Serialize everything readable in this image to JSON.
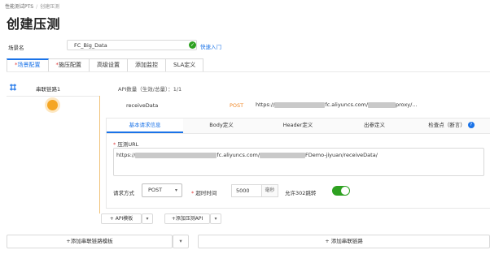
{
  "breadcrumb": {
    "root": "性能测试PTS",
    "separator": "/",
    "current": "创建压测"
  },
  "page_title": "创建压测",
  "scene": {
    "label": "场景名",
    "value": "FC_Big_Data",
    "quick_link": "快速入门"
  },
  "tabs": [
    {
      "label": "场景配置",
      "required": "*"
    },
    {
      "label": "施压配置",
      "required": "*"
    },
    {
      "label": "高级设置",
      "required": ""
    },
    {
      "label": "添加监控",
      "required": ""
    },
    {
      "label": "SLA定义",
      "required": ""
    }
  ],
  "chain": {
    "name": "串联链路1",
    "api_count": "API数量（生效/总量）：1/1"
  },
  "api": {
    "name": "receiveData",
    "method": "POST",
    "url_prefix": "https://",
    "url_mid": "fc.aliyuncs.com/",
    "url_suffix": "proxy/..."
  },
  "subtabs": [
    "基本请求信息",
    "Body定义",
    "Header定义",
    "出参定义",
    "检查点（断言）"
  ],
  "form": {
    "url_label": "压测URL",
    "url_prefix": "https://",
    "url_mid": "fc.aliyuncs.com/",
    "url_suffix": "FDemo-jiyuan/receiveData/",
    "method_label": "请求方式",
    "method_value": "POST",
    "timeout_label": "超时时间",
    "timeout_value": "5000",
    "timeout_unit": "毫秒",
    "redirect_label": "允许302跳转",
    "redirect_enabled": true
  },
  "buttons": {
    "api_template": "+ API模板",
    "add_api": "+添加压测API",
    "add_chain_template": "+添加串联链路模板",
    "add_chain": "+ 添加串联链路"
  },
  "colors": {
    "accent": "#1a73e8",
    "success": "#2ea121",
    "method": "#f0892a",
    "node": "#f5a623"
  }
}
